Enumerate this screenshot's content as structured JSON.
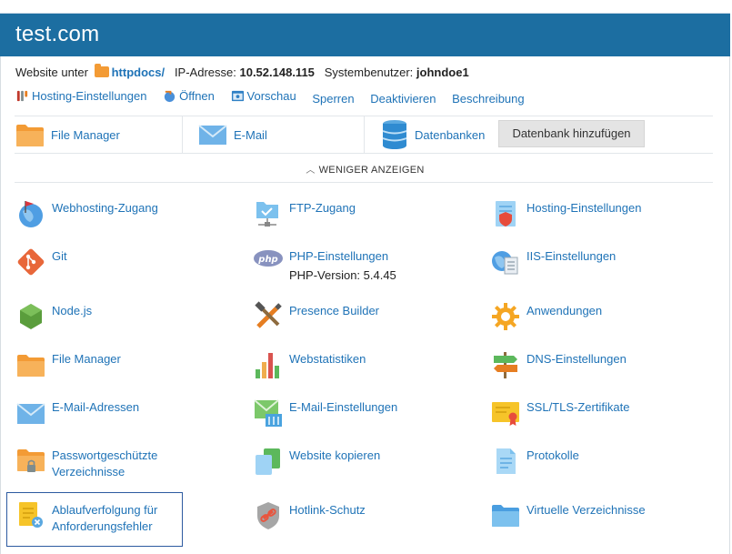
{
  "header": {
    "title": "test.com"
  },
  "info": {
    "website_prefix": "Website unter",
    "docroot": "httpdocs/",
    "ip_label": "IP-Adresse:",
    "ip_value": "10.52.148.115",
    "user_label": "Systembenutzer:",
    "user_value": "johndoe1"
  },
  "actions": {
    "hosting_settings": "Hosting-Einstellungen",
    "open": "Öffnen",
    "preview": "Vorschau",
    "lock": "Sperren",
    "deactivate": "Deaktivieren",
    "description": "Beschreibung"
  },
  "tiles": {
    "file_manager": "File Manager",
    "email": "E-Mail",
    "databases": "Datenbanken",
    "add_database": "Datenbank hinzufügen"
  },
  "toggle": {
    "show_less": "WENIGER ANZEIGEN"
  },
  "tools": {
    "webhosting_access": "Webhosting-Zugang",
    "ftp_access": "FTP-Zugang",
    "hosting_settings": "Hosting-Einstellungen",
    "git": "Git",
    "php_settings": "PHP-Einstellungen",
    "php_version": "PHP-Version: 5.4.45",
    "iis_settings": "IIS-Einstellungen",
    "nodejs": "Node.js",
    "presence_builder": "Presence Builder",
    "applications": "Anwendungen",
    "file_manager": "File Manager",
    "web_statistics": "Webstatistiken",
    "dns_settings": "DNS-Einstellungen",
    "email_addresses": "E-Mail-Adressen",
    "email_settings": "E-Mail-Einstellungen",
    "ssl_certificates": "SSL/TLS-Zertifikate",
    "protected_dirs_1": "Passwortgeschützte",
    "protected_dirs_2": "Verzeichnisse",
    "copy_website": "Website kopieren",
    "logs": "Protokolle",
    "failed_request_1": "Ablaufverfolgung für",
    "failed_request_2": "Anforderungsfehler",
    "hotlink_protection": "Hotlink-Schutz",
    "virtual_dirs": "Virtuelle Verzeichnisse"
  },
  "colors": {
    "header_bg": "#1c6ea1",
    "link": "#1f73b7",
    "folder": "#f39b35"
  }
}
